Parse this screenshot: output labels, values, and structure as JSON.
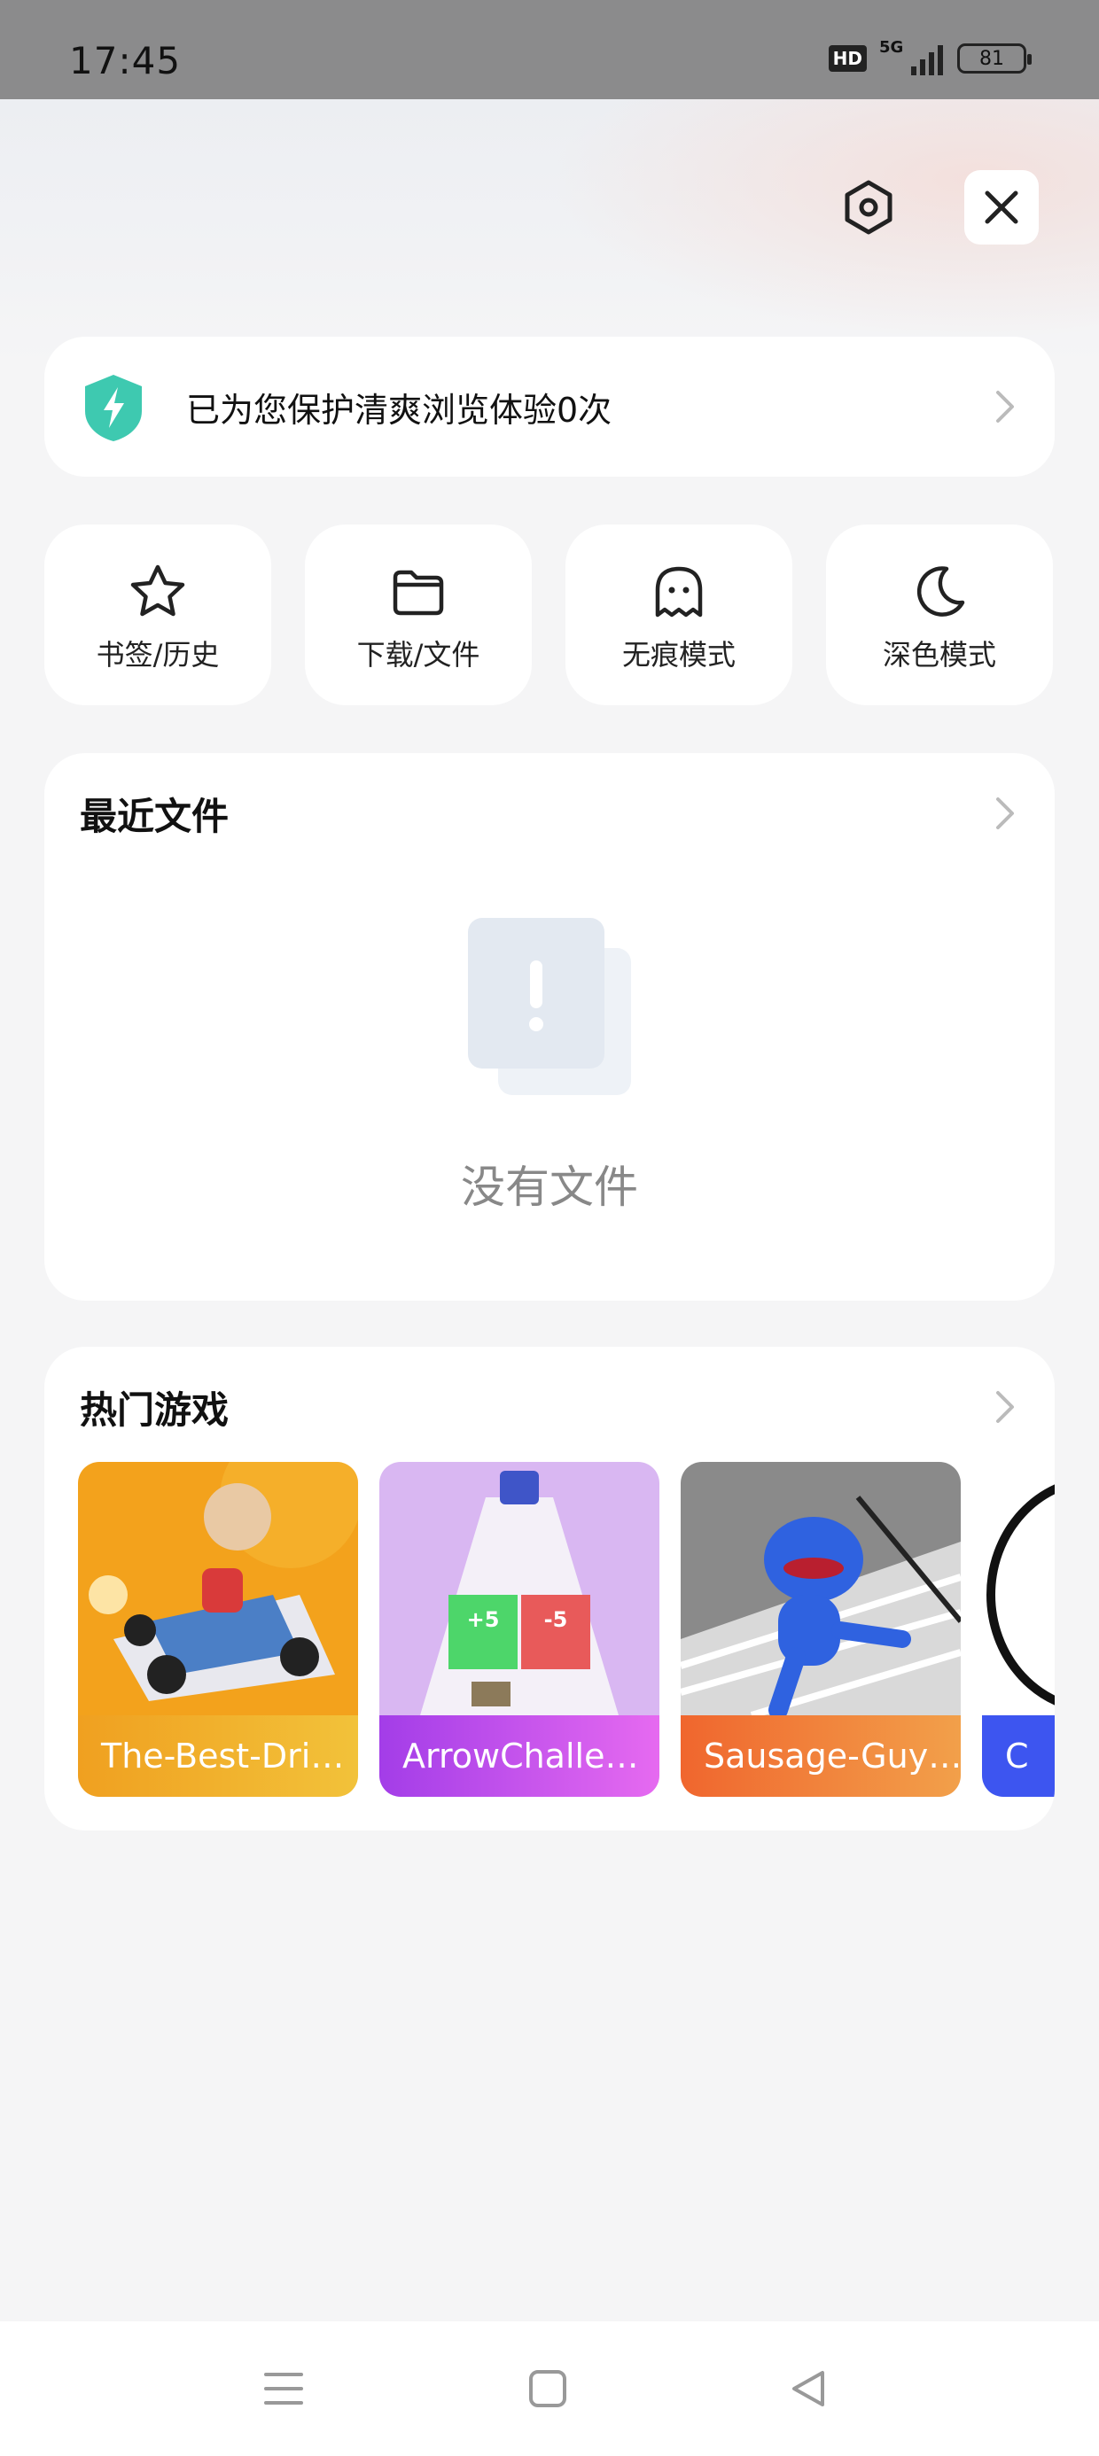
{
  "status_bar": {
    "time": "17:45",
    "hd_badge": "HD",
    "network": "5G",
    "battery": "81",
    "icons": [
      "hd-icon",
      "5g-signal-icon",
      "battery-icon"
    ]
  },
  "header": {
    "buttons": [
      "settings-icon",
      "close-icon"
    ]
  },
  "protect_banner": {
    "text": "已为您保护清爽浏览体验0次",
    "icon": "shield-bolt-icon",
    "accent": "#3ec9b0"
  },
  "quick_actions": [
    {
      "label": "书签/历史",
      "icon": "star-icon"
    },
    {
      "label": "下载/文件",
      "icon": "folder-icon"
    },
    {
      "label": "无痕模式",
      "icon": "ghost-icon"
    },
    {
      "label": "深色模式",
      "icon": "moon-icon"
    }
  ],
  "recent_files": {
    "title": "最近文件",
    "empty_text": "没有文件",
    "empty_icon": "empty-document-icon"
  },
  "hot_games": {
    "title": "热门游戏",
    "games": [
      {
        "label": "The-Best-Dri…",
        "color": "#f0a020"
      },
      {
        "label": "ArrowChalle…",
        "color": "#b44df0"
      },
      {
        "label": "Sausage-Guy…",
        "color": "#f07a3a"
      },
      {
        "label": "C",
        "color": "#3d55f0"
      }
    ]
  },
  "nav_bar": {
    "buttons": [
      "menu-icon",
      "home-square-icon",
      "back-triangle-icon"
    ]
  }
}
